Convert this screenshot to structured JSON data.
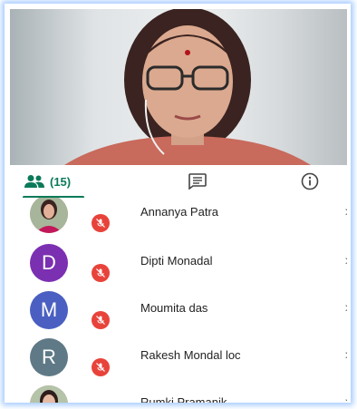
{
  "tabs": {
    "participants_count": "(15)"
  },
  "participants": [
    {
      "name": "Annanya Patra",
      "initial": "",
      "avatar_type": "photo",
      "color": "#c08080"
    },
    {
      "name": "Dipti Monadal",
      "initial": "D",
      "avatar_type": "letter",
      "color": "#7b2fb1"
    },
    {
      "name": "Moumita das",
      "initial": "M",
      "avatar_type": "letter",
      "color": "#4a5fc1"
    },
    {
      "name": "Rakesh Mondal loc",
      "initial": "R",
      "avatar_type": "letter",
      "color": "#5f7a86"
    },
    {
      "name": "Rumki Pramanik",
      "initial": "",
      "avatar_type": "photo",
      "color": "#9a7a6a"
    }
  ],
  "chevron": ">",
  "colors": {
    "accent": "#0b7a5a",
    "mute": "#e8433a"
  }
}
